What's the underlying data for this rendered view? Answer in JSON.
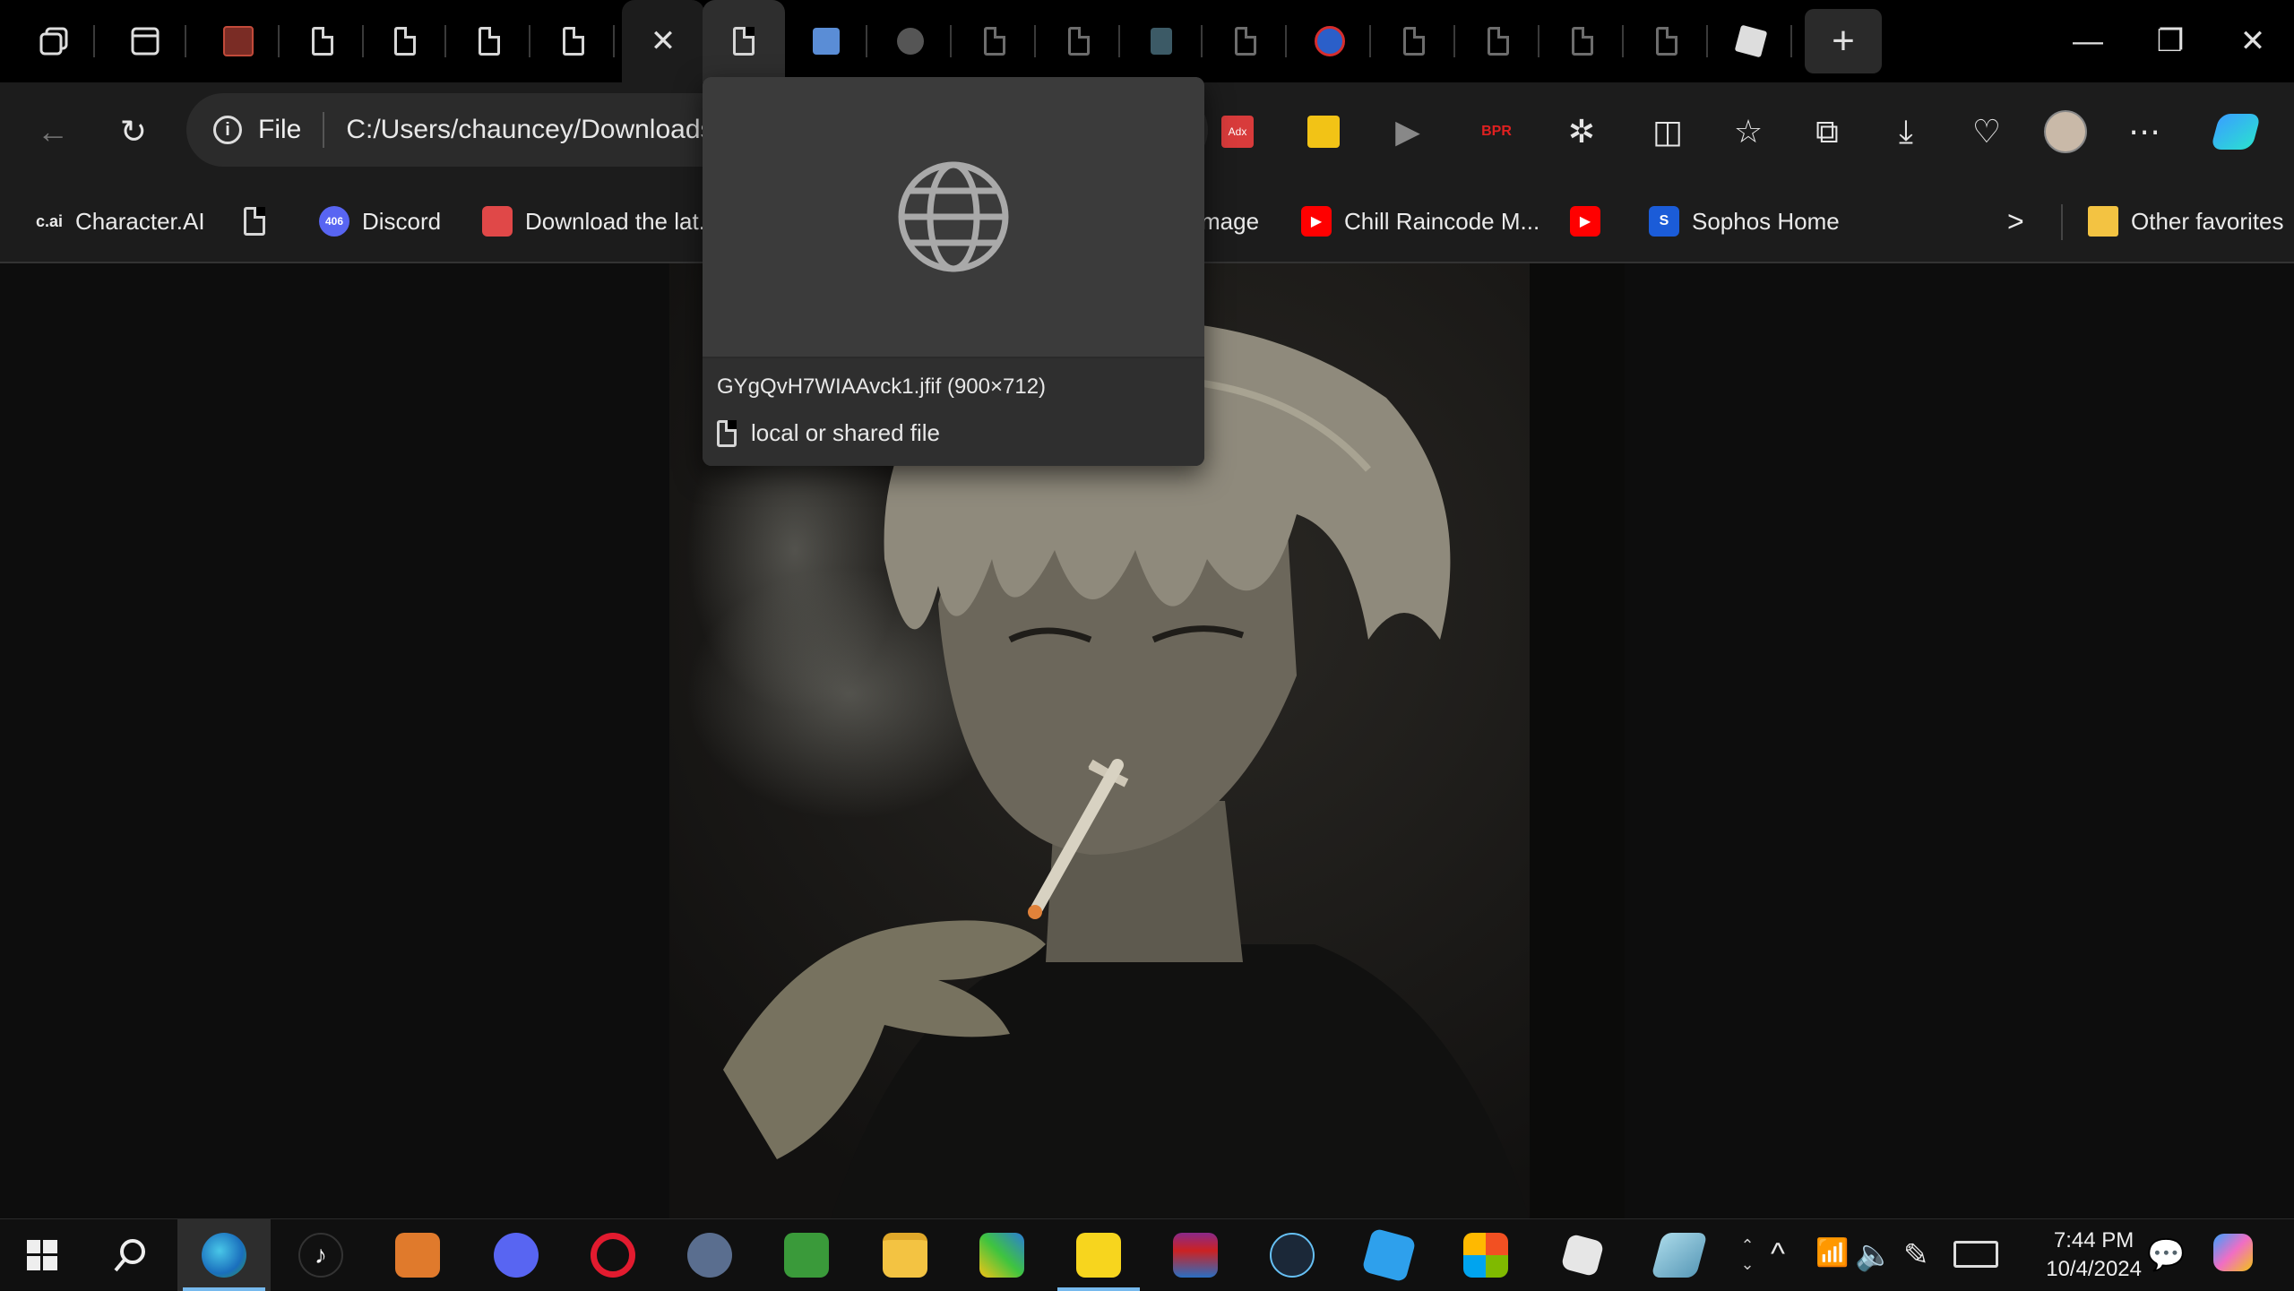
{
  "browser": {
    "tabs_hover_preview": {
      "filename": "GYgQvH7WIAAvck1.jfif (900×712)",
      "source": "local or shared file"
    },
    "new_tab_label": "+",
    "window_controls": {
      "minimize": "—",
      "restore": "❐",
      "close": "✕"
    }
  },
  "toolbar": {
    "site_info_label": "File",
    "address": "C:/Users/chauncey/Downloads/6",
    "ext_adx": "Adx",
    "ext_bpr": "BPR"
  },
  "favorites": {
    "items": [
      {
        "label": "Character.AI",
        "badge": "c.ai"
      },
      {
        "label": ""
      },
      {
        "label": "Discord",
        "badge": "406"
      },
      {
        "label": "Download the lat..."
      },
      {
        "label": "mage"
      },
      {
        "label": "Chill Raincode M..."
      },
      {
        "label": ""
      },
      {
        "label": "Sophos Home",
        "badge": "S"
      }
    ],
    "overflow": ">",
    "other": "Other favorites"
  },
  "taskbar": {
    "time": "7:44 PM",
    "date": "10/4/2024"
  },
  "colors": {
    "tabstrip": "#000000",
    "toolbar": "#1c1c1c",
    "accent": "#76b9ed"
  }
}
